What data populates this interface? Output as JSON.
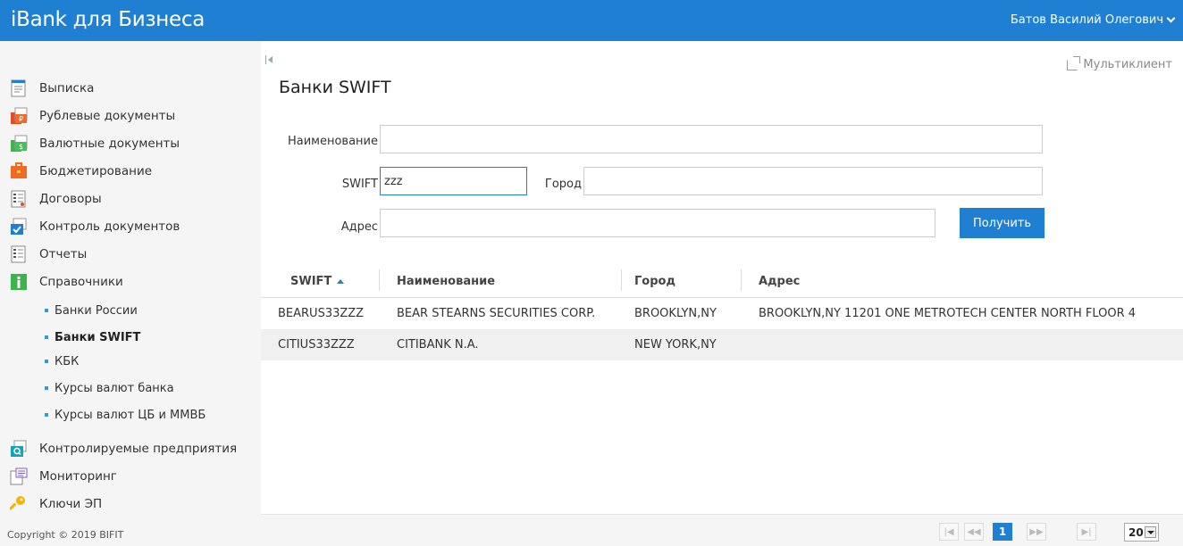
{
  "header": {
    "app_title": "iBank для Бизнеса",
    "user_name": "Батов Василий Олегович"
  },
  "sidebar": {
    "items": [
      {
        "label": "Выписка",
        "icon": "statement-icon"
      },
      {
        "label": "Рублевые документы",
        "icon": "ruble-docs-icon"
      },
      {
        "label": "Валютные документы",
        "icon": "currency-docs-icon"
      },
      {
        "label": "Бюджетирование",
        "icon": "budget-icon"
      },
      {
        "label": "Договоры",
        "icon": "contracts-icon"
      },
      {
        "label": "Контроль документов",
        "icon": "doc-control-icon"
      },
      {
        "label": "Отчеты",
        "icon": "reports-icon"
      },
      {
        "label": "Справочники",
        "icon": "info-icon"
      }
    ],
    "subitems": [
      {
        "label": "Банки России"
      },
      {
        "label": "Банки SWIFT"
      },
      {
        "label": "КБК"
      },
      {
        "label": "Курсы валют банка"
      },
      {
        "label": "Курсы валют ЦБ и ММВБ"
      }
    ],
    "bottom_items": [
      {
        "label": "Контролируемые предприятия",
        "icon": "controlled-companies-icon"
      },
      {
        "label": "Мониторинг",
        "icon": "monitoring-icon"
      },
      {
        "label": "Ключи ЭП",
        "icon": "key-icon"
      }
    ],
    "copyright": "Copyright © 2019 BIFIT"
  },
  "main": {
    "multiclient_label": "Мультиклиент",
    "title": "Банки SWIFT",
    "form": {
      "name_label": "Наименование",
      "name_value": "",
      "swift_label": "SWIFT",
      "swift_value": "zzz",
      "city_label": "Город",
      "city_value": "",
      "address_label": "Адрес",
      "address_value": "",
      "submit_label": "Получить"
    },
    "table": {
      "columns": [
        "SWIFT",
        "Наименование",
        "Город",
        "Адрес"
      ],
      "rows": [
        [
          "BEARUS33ZZZ",
          "BEAR STEARNS SECURITIES CORP.",
          "BROOKLYN,NY",
          "BROOKLYN,NY 11201 ONE METROTECH CENTER NORTH FLOOR 4"
        ],
        [
          "CITIUS33ZZZ",
          "CITIBANK N.A.",
          "NEW YORK,NY",
          ""
        ]
      ]
    },
    "pager": {
      "current_page": "1",
      "page_size": "20"
    }
  },
  "colors": {
    "accent": "#1e7fd3",
    "sidebar_bg": "#f5f5f5",
    "sub_dot": "#2a9fd6"
  }
}
